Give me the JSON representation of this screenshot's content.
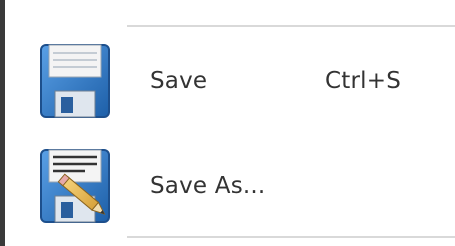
{
  "menu": {
    "items": [
      {
        "label": "Save",
        "shortcut": "Ctrl+S",
        "icon": "floppy-disk-icon"
      },
      {
        "label": "Save As...",
        "shortcut": "",
        "icon": "floppy-disk-pencil-icon"
      }
    ]
  },
  "colors": {
    "disk_blue": "#2f78c7",
    "disk_dark": "#1d4f8c",
    "border": "#3a3a3a",
    "separator": "#d9d9d9",
    "text": "#333333"
  }
}
